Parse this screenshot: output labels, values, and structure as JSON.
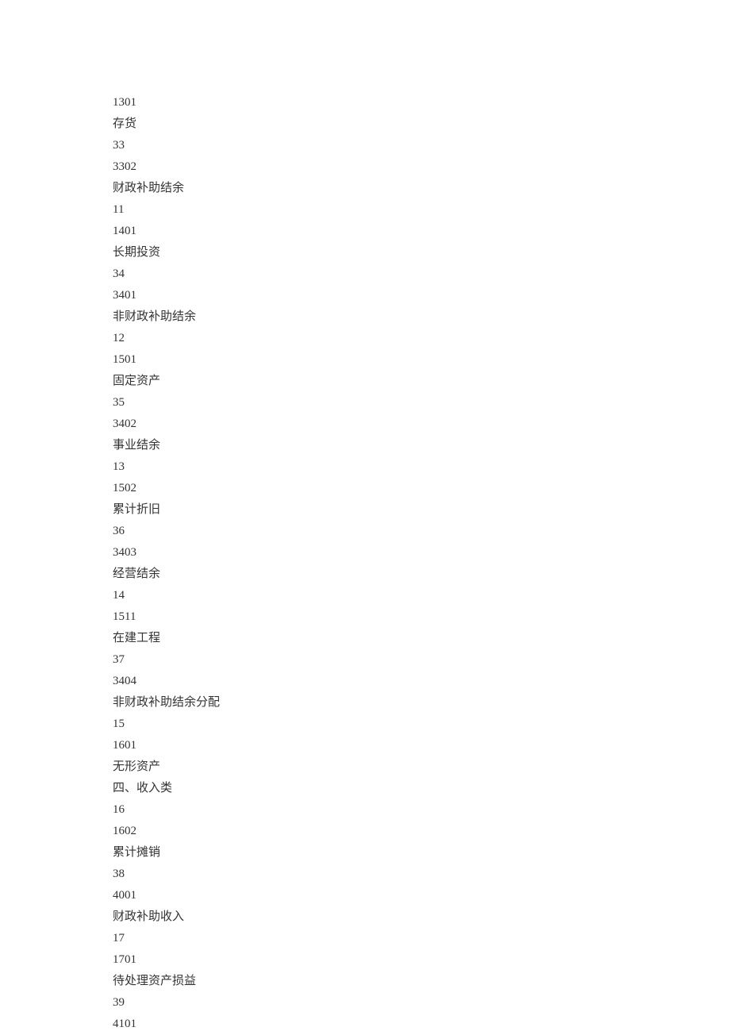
{
  "lines": [
    "1301",
    "存货",
    "33",
    "3302",
    "财政补助结余",
    "11",
    "1401",
    "长期投资",
    "34",
    "3401",
    "非财政补助结余",
    "12",
    "1501",
    "固定资产",
    "35",
    "3402",
    "事业结余",
    "13",
    "1502",
    "累计折旧",
    "36",
    "3403",
    "经营结余",
    "14",
    "1511",
    "在建工程",
    "37",
    "3404",
    "非财政补助结余分配",
    "15",
    "1601",
    "无形资产",
    "四、收入类",
    "16",
    "1602",
    "累计摊销",
    "38",
    "4001",
    "财政补助收入",
    "17",
    "1701",
    "待处理资产损益",
    "39",
    "4101"
  ]
}
